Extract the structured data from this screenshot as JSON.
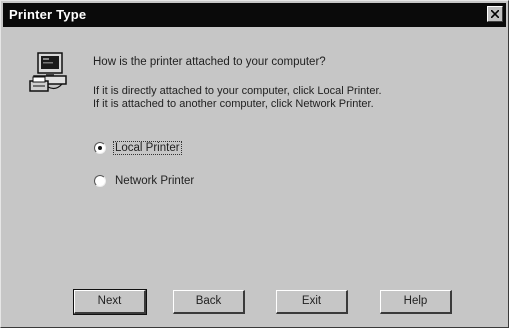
{
  "window": {
    "title": "Printer Type",
    "close_icon": "close-icon"
  },
  "content": {
    "icon": "computer-printer-icon",
    "question": "How is the printer attached to your computer?",
    "instruction_line1": "If it is directly attached to your computer, click Local Printer.",
    "instruction_line2": "If it is attached to another computer, click Network Printer."
  },
  "options": [
    {
      "label": "Local Printer",
      "selected": true
    },
    {
      "label": "Network Printer",
      "selected": false
    }
  ],
  "buttons": {
    "next": "Next",
    "back": "Back",
    "exit": "Exit",
    "help": "Help"
  }
}
